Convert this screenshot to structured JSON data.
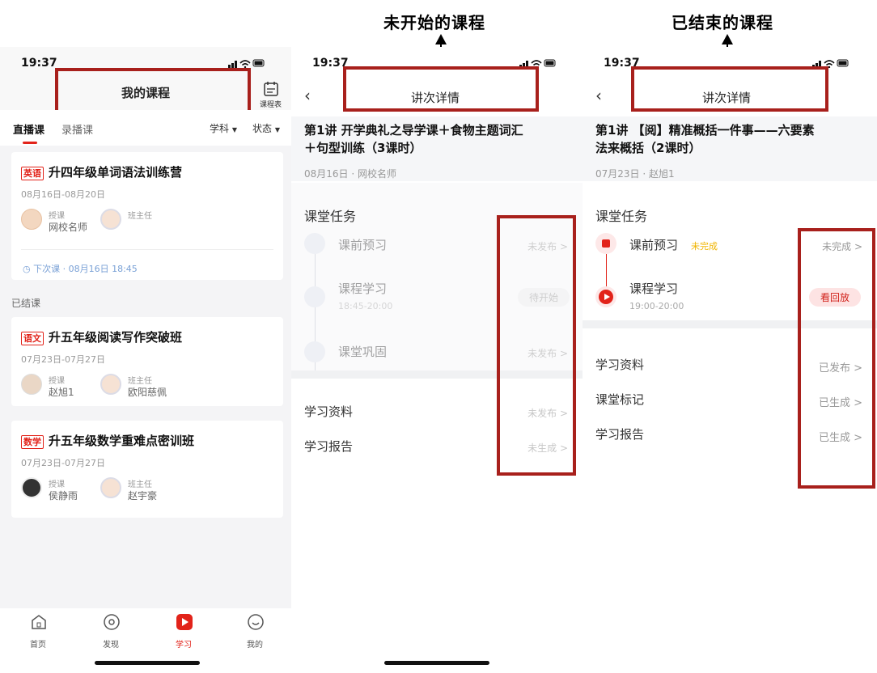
{
  "annotations": {
    "label_not_started": "未开始的课程",
    "label_ended": "已结束的课程"
  },
  "status_time": "19:37",
  "screen1": {
    "header_title": "我的课程",
    "schedule_label": "课程表",
    "tabs": [
      "直播课",
      "录播课"
    ],
    "filters": [
      "学科",
      "状态"
    ],
    "courses": [
      {
        "subject": "英语",
        "title": "升四年级单词语法训练营",
        "date": "08月16日-08月20日",
        "teacher_role": "授课",
        "teacher": "网校名师",
        "head_role": "班主任",
        "head": "",
        "next_class": "下次课 · 08月16日  18:45"
      }
    ],
    "ended_label": "已结课",
    "ended_courses": [
      {
        "subject": "语文",
        "title": "升五年级阅读写作突破班",
        "date": "07月23日-07月27日",
        "teacher_role": "授课",
        "teacher": "赵旭1",
        "head_role": "班主任",
        "head": "欧阳慈佩"
      },
      {
        "subject": "数学",
        "title": "升五年级数学重难点密训班",
        "date": "07月23日-07月27日",
        "teacher_role": "授课",
        "teacher": "侯静雨",
        "head_role": "班主任",
        "head": "赵宇豪"
      }
    ],
    "bottom_nav": [
      "首页",
      "发现",
      "学习",
      "我的"
    ]
  },
  "screen2": {
    "header_title": "讲次详情",
    "lesson_title_line1": "第1讲  开学典礼之导学课＋食物主题词汇",
    "lesson_title_line2": "＋句型训练（3课时）",
    "meta": "08月16日 · 网校名师",
    "tasks_heading": "课堂任务",
    "tasks": [
      {
        "name": "课前预习",
        "time": "",
        "status": "未发布 >"
      },
      {
        "name": "课程学习",
        "time": "18:45-20:00",
        "status": "待开始"
      },
      {
        "name": "课堂巩固",
        "time": "",
        "status": "未发布 >"
      }
    ],
    "rows": [
      {
        "label": "学习资料",
        "status": "未发布 >"
      },
      {
        "label": "学习报告",
        "status": "未生成 >"
      }
    ]
  },
  "screen3": {
    "header_title": "讲次详情",
    "lesson_title_line1": "第1讲  【阅】精准概括一件事——六要素",
    "lesson_title_line2": "法来概括（2课时）",
    "meta": "07月23日 · 赵旭1",
    "tasks_heading": "课堂任务",
    "tasks": [
      {
        "name": "课前预习",
        "badge": "未完成",
        "time": "",
        "status": "未完成 >"
      },
      {
        "name": "课程学习",
        "badge": "",
        "time": "19:00-20:00",
        "status": "看回放"
      }
    ],
    "rows": [
      {
        "label": "学习资料",
        "status": "已发布 >"
      },
      {
        "label": "课堂标记",
        "status": "已生成 >"
      },
      {
        "label": "学习报告",
        "status": "已生成 >"
      }
    ]
  },
  "colors": {
    "accent": "#e2231a",
    "annotation_box": "#a8201c",
    "pending": "#f0b400"
  }
}
